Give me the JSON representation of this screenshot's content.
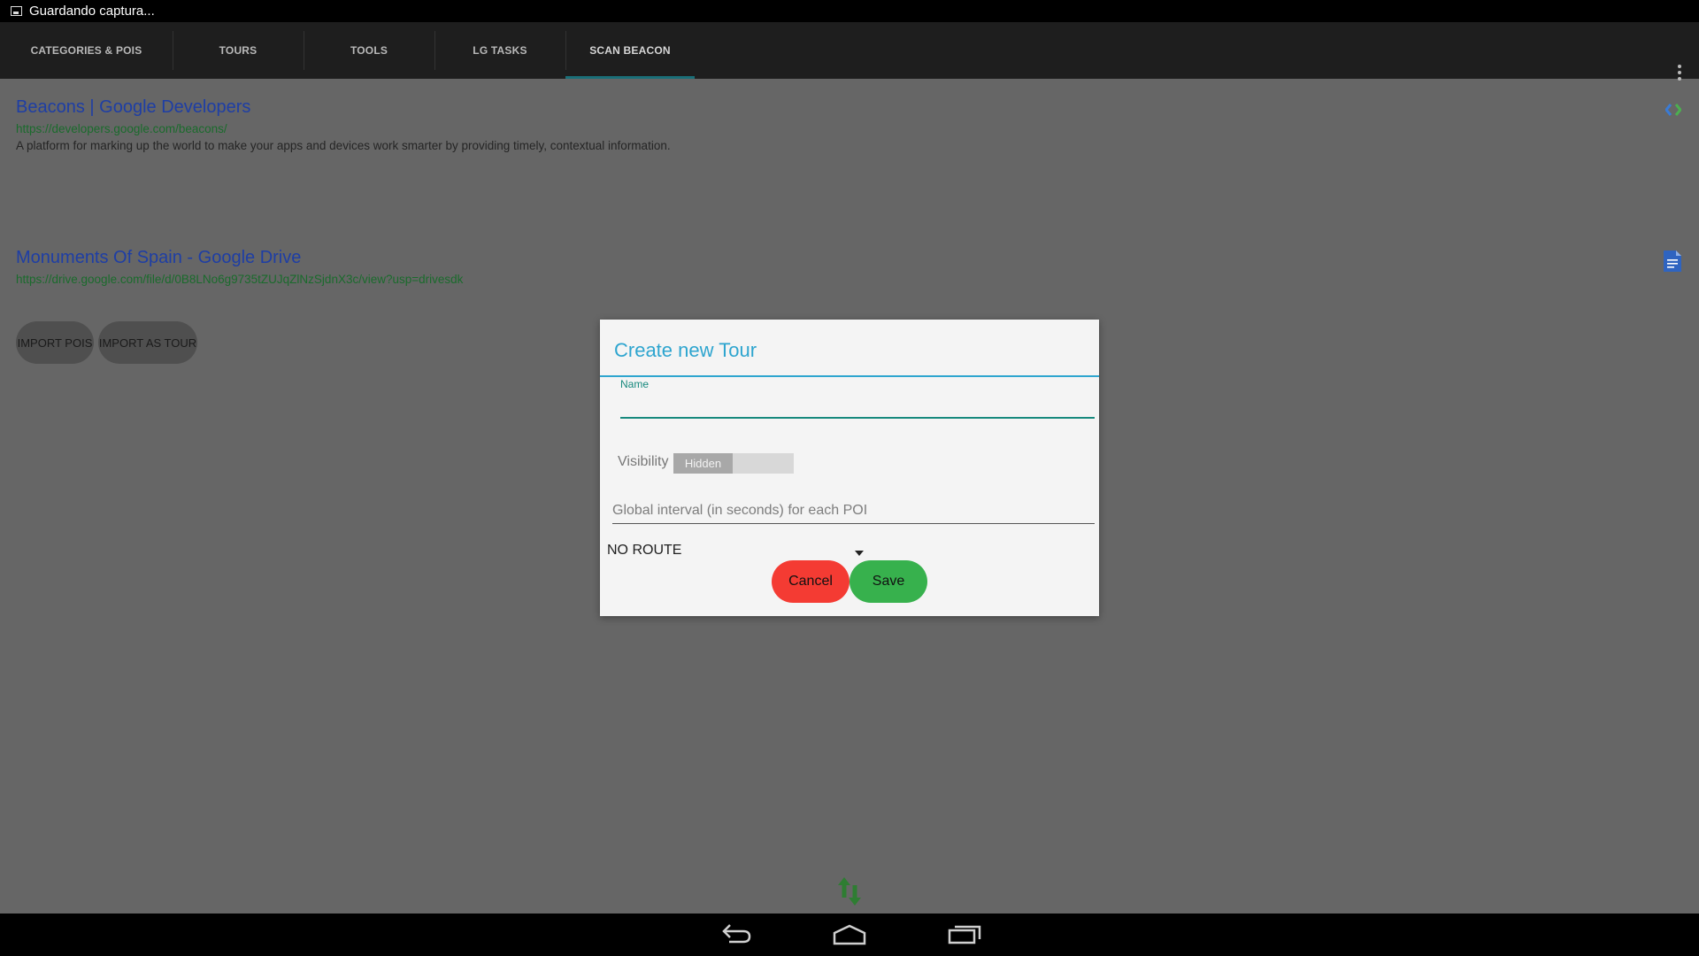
{
  "status_bar": {
    "text": "Guardando captura..."
  },
  "tabs": [
    {
      "label": "CATEGORIES & POIS"
    },
    {
      "label": "TOURS"
    },
    {
      "label": "TOOLS"
    },
    {
      "label": "LG TASKS"
    },
    {
      "label": "SCAN BEACON",
      "active": true
    }
  ],
  "results": [
    {
      "title": "Beacons  |  Google Developers",
      "url": "https://developers.google.com/beacons/",
      "description": "A platform for marking up the world to make your apps and devices work smarter by providing timely, contextual information.",
      "icon": "google-developers-logo-icon"
    },
    {
      "title": "Monuments Of Spain - Google Drive",
      "url": "https://drive.google.com/file/d/0B8LNo6g9735tZUJqZlNzSjdnX3c/view?usp=drivesdk",
      "icon": "document-icon"
    }
  ],
  "actions": {
    "import_pois": "IMPORT POIS",
    "import_as_tour": "IMPORT AS TOUR"
  },
  "dialog": {
    "title": "Create new Tour",
    "name_label": "Name",
    "name_value": "",
    "visibility_label": "Visibility",
    "visibility_value": "Hidden",
    "interval_placeholder": "Global interval (in seconds) for each POI",
    "route_value": "NO ROUTE",
    "cancel_label": "Cancel",
    "save_label": "Save"
  },
  "colors": {
    "accent": "#2ea5cf",
    "input_focus": "#17897d",
    "cancel": "#f43b33",
    "save": "#37b14d",
    "link_title": "#1e3ea5",
    "link_url": "#1a6b2c"
  }
}
